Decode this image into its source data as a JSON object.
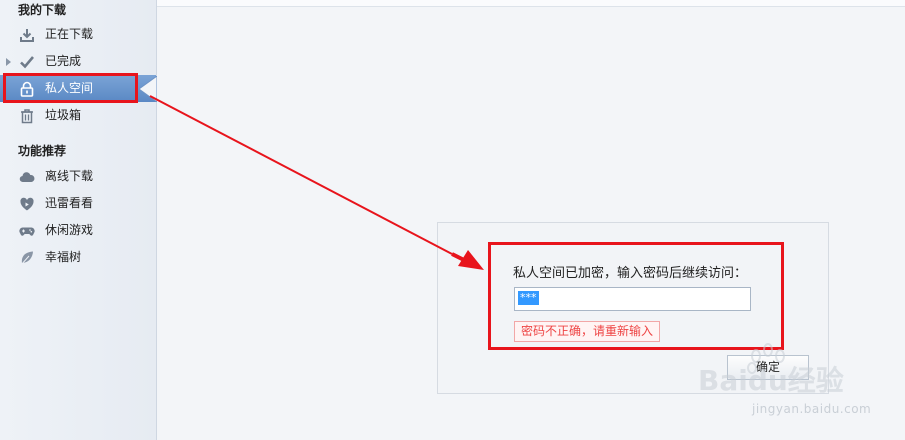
{
  "sidebar": {
    "sections": [
      {
        "title": "我的下载"
      },
      {
        "title": "功能推荐"
      }
    ],
    "download_items": [
      {
        "label": "正在下载",
        "icon": "download-icon"
      },
      {
        "label": "已完成",
        "icon": "check-icon"
      },
      {
        "label": "私人空间",
        "icon": "lock-icon",
        "active": true
      },
      {
        "label": "垃圾箱",
        "icon": "trash-icon"
      }
    ],
    "feature_items": [
      {
        "label": "离线下载",
        "icon": "cloud-icon"
      },
      {
        "label": "迅雷看看",
        "icon": "heart-play-icon"
      },
      {
        "label": "休闲游戏",
        "icon": "gamepad-icon"
      },
      {
        "label": "幸福树",
        "icon": "leaf-icon"
      }
    ]
  },
  "dialog": {
    "prompt": "私人空间已加密，输入密码后继续访问：",
    "password_value": "***",
    "error": "密码不正确，请重新输入",
    "ok_label": "确定"
  },
  "watermark": {
    "brand": "Baidu经验",
    "url": "jingyan.baidu.com"
  },
  "colors": {
    "annotation": "#e8141c",
    "active_item": "#5a88c4",
    "selection": "#3399ff"
  }
}
